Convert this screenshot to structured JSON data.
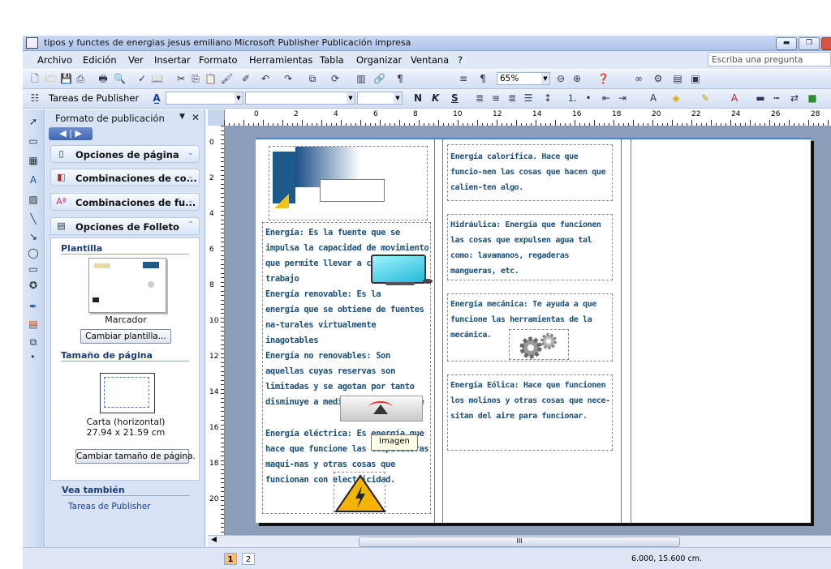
{
  "window": {
    "title": "tipos y functes de energias jesus emiliano   Microsoft Publisher   Publicación impresa"
  },
  "menu": {
    "items": [
      "Archivo",
      "Edición",
      "Ver",
      "Insertar",
      "Formato",
      "Herramientas",
      "Tabla",
      "Organizar",
      "Ventana",
      "?"
    ],
    "ask_placeholder": "Escriba una pregunta"
  },
  "toolbar": {
    "zoom": "65%",
    "tasks_label": "Tareas de Publisher",
    "format_buttons": [
      "N",
      "K",
      "S"
    ]
  },
  "taskpane": {
    "title": "Formato de publicación",
    "sections": [
      {
        "label": "Opciones de página",
        "icon": "page-options-icon"
      },
      {
        "label": "Combinaciones de co...",
        "icon": "color-schemes-icon"
      },
      {
        "label": "Combinaciones de fu...",
        "icon": "font-schemes-icon"
      },
      {
        "label": "Opciones de Folleto",
        "icon": "brochure-options-icon"
      }
    ],
    "template_heading": "Plantilla",
    "template_name": "Marcador",
    "change_template": "Cambiar plantilla...",
    "page_size_heading": "Tamaño de página",
    "page_size_name": "Carta (horizontal)",
    "page_size_dims": "27.94 x 21.59 cm",
    "change_page_size": "Cambiar tamaño de página.",
    "see_also_heading": "Vea también",
    "see_also_link": "Tareas de Publisher"
  },
  "ruler": {
    "h_labels": [
      "0",
      "2",
      "4",
      "6",
      "8",
      "10",
      "12",
      "14",
      "16",
      "18",
      "20",
      "22",
      "24",
      "26",
      "28"
    ],
    "v_labels": [
      "0",
      "2",
      "4",
      "6",
      "8",
      "10",
      "12",
      "14",
      "16",
      "18",
      "20"
    ]
  },
  "document": {
    "col1": {
      "p1": "Energía: Es la fuente que se impulsa la capacidad de movimiento que permite llevar a cabo un trabajo",
      "p2": "Energía renovable: Es la\nenergía que se obtiene de fuentes na-turales virtualmente inagotables",
      "p3": "Energía no renovables: Son aquellas cuyas reservas son limitadas y se agotan por tanto disminuye a medida que se consume",
      "p4": "Energía eléctrica: Es energía que hace que funcione las computadoras maqui-nas y otras cosas que funcionan con electricidad."
    },
    "col2": {
      "p1": "Energía calorífica. Hace que funcio-nen las cosas que hacen que calien-ten algo.",
      "p2": "Hidráulica: Energía que funcionen las cosas que expulsen agua tal como: lavamanos, regaderas mangueras, etc.",
      "p3": "Energía mecánica: Te ayuda a que funcione las herramientas de la mecánica.",
      "p4": "Energía Eólica: Hace que funcionen los molinos y otras cosas que nece-sitan del aire para funcionar."
    },
    "tooltip": "Imagen"
  },
  "status": {
    "pages": [
      "1",
      "2"
    ],
    "coords": "6.000, 15.600 cm."
  },
  "colors": {
    "accent": "#1a4f7a",
    "workspace": "#8c9db9",
    "guide": "#4a7fd0"
  }
}
